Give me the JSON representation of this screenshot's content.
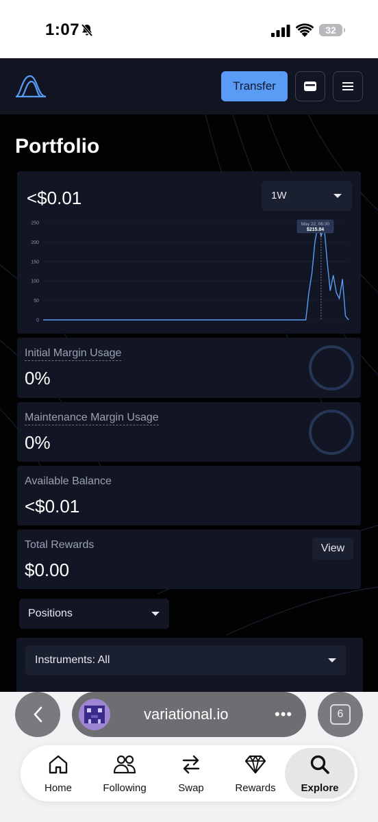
{
  "status_bar": {
    "time": "1:07",
    "battery": "32"
  },
  "header": {
    "transfer_label": "Transfer"
  },
  "page": {
    "title": "Portfolio"
  },
  "portfolio_chart": {
    "value": "<$0.01",
    "range": "1W",
    "tooltip_date": "May 22, 06:30",
    "tooltip_value": "$215.84"
  },
  "chart_data": {
    "type": "line",
    "yticks": [
      "250",
      "200",
      "150",
      "100",
      "50",
      "0"
    ],
    "ylim": [
      0,
      250
    ],
    "x": [
      0,
      25,
      50,
      75,
      86,
      87,
      88,
      89,
      90,
      91,
      92,
      93,
      94,
      95,
      96,
      97,
      98,
      99,
      100
    ],
    "values": [
      0,
      0,
      0,
      0,
      0,
      70,
      120,
      200,
      245,
      215,
      240,
      150,
      75,
      115,
      70,
      55,
      105,
      10,
      0
    ],
    "line_color": "#5a9cf5"
  },
  "metrics": {
    "initial_margin": {
      "label": "Initial Margin Usage",
      "value": "0%"
    },
    "maintenance_margin": {
      "label": "Maintenance Margin Usage",
      "value": "0%"
    },
    "available_balance": {
      "label": "Available Balance",
      "value": "<$0.01"
    },
    "total_rewards": {
      "label": "Total Rewards",
      "value": "$0.00",
      "button": "View"
    }
  },
  "positions": {
    "select_label": "Positions",
    "instruments_label": "Instruments: All"
  },
  "browser": {
    "url": "variational.io",
    "more": "•••",
    "tab_count": "6",
    "nav": [
      {
        "label": "Home",
        "icon": "home-icon"
      },
      {
        "label": "Following",
        "icon": "people-icon"
      },
      {
        "label": "Swap",
        "icon": "swap-icon"
      },
      {
        "label": "Rewards",
        "icon": "diamond-icon"
      },
      {
        "label": "Explore",
        "icon": "search-icon"
      }
    ]
  },
  "colors": {
    "accent": "#5a9cf5",
    "card": "#121624",
    "ring": "#253656"
  }
}
